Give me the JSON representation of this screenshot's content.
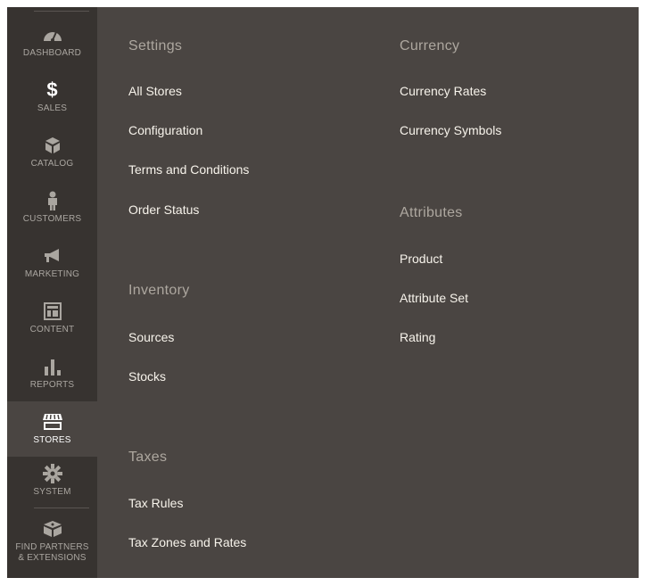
{
  "sidebar": {
    "items": [
      {
        "label": "DASHBOARD",
        "icon": "dashboard-gauge-icon"
      },
      {
        "label": "SALES",
        "icon": "dollar-icon"
      },
      {
        "label": "CATALOG",
        "icon": "box-icon"
      },
      {
        "label": "CUSTOMERS",
        "icon": "person-icon"
      },
      {
        "label": "MARKETING",
        "icon": "megaphone-icon"
      },
      {
        "label": "CONTENT",
        "icon": "layout-icon"
      },
      {
        "label": "REPORTS",
        "icon": "bar-chart-icon"
      },
      {
        "label": "STORES",
        "icon": "storefront-icon",
        "active": true
      },
      {
        "label": "SYSTEM",
        "icon": "gear-icon"
      },
      {
        "label": "FIND PARTNERS\n& EXTENSIONS",
        "label_line1": "FIND PARTNERS",
        "label_line2": "& EXTENSIONS",
        "icon": "extensions-box-icon"
      }
    ]
  },
  "menu": {
    "settings": {
      "heading": "Settings",
      "links": [
        "All Stores",
        "Configuration",
        "Terms and Conditions",
        "Order Status"
      ]
    },
    "inventory": {
      "heading": "Inventory",
      "links": [
        "Sources",
        "Stocks"
      ]
    },
    "taxes": {
      "heading": "Taxes",
      "links": [
        "Tax Rules",
        "Tax Zones and Rates"
      ]
    },
    "currency": {
      "heading": "Currency",
      "links": [
        "Currency Rates",
        "Currency Symbols"
      ]
    },
    "attributes": {
      "heading": "Attributes",
      "links": [
        "Product",
        "Attribute Set",
        "Rating"
      ]
    }
  },
  "colors": {
    "sidebar_bg": "#373330",
    "sidebar_active_bg": "#4a4542",
    "panel_bg": "#4a4542",
    "heading": "#ada79f",
    "link": "#f7f3eb"
  }
}
